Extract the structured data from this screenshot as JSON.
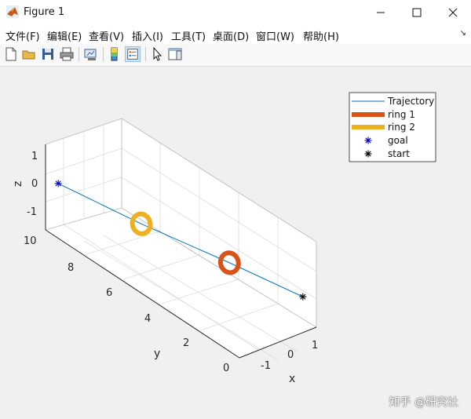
{
  "window": {
    "title": "Figure 1",
    "controls": {
      "minimize": "—",
      "maximize": "☐",
      "close": "✕"
    }
  },
  "menubar": {
    "items": [
      "文件(F)",
      "编辑(E)",
      "查看(V)",
      "插入(I)",
      "工具(T)",
      "桌面(D)",
      "窗口(W)",
      "帮助(H)"
    ]
  },
  "toolbar": {
    "buttons": [
      "new-figure-icon",
      "open-file-icon",
      "save-icon",
      "print-icon",
      "link-plot-icon",
      "colorbar-icon",
      "legend-icon",
      "pointer-icon",
      "property-editor-icon"
    ]
  },
  "chart_data": {
    "type": "line",
    "view": "3d",
    "xlabel": "x",
    "ylabel": "y",
    "zlabel": "z",
    "xticks": [
      "-1",
      "0",
      "1"
    ],
    "yticks": [
      "0",
      "2",
      "4",
      "6",
      "8",
      "10"
    ],
    "zticks": [
      "-1",
      "0",
      "1"
    ],
    "xlim": [
      -1.5,
      1.5
    ],
    "ylim": [
      0,
      10
    ],
    "zlim": [
      -1.5,
      1.5
    ],
    "grid": true,
    "legend_position": "top-right",
    "colors": {
      "trajectory": "#0072bd",
      "ring1": "#d95319",
      "ring2": "#edb120",
      "goal": "#0000b8",
      "start": "#000000"
    },
    "series": [
      {
        "name": "Trajectory",
        "x": [
          1.0,
          0.4,
          -0.4,
          -1.0
        ],
        "y": [
          0.0,
          3.0,
          6.5,
          10.0
        ],
        "z": [
          0.0,
          0.0,
          0.0,
          0.0
        ]
      },
      {
        "name": "ring 1",
        "center": [
          0.4,
          3.0,
          0.0
        ],
        "radius": 0.35
      },
      {
        "name": "ring 2",
        "center": [
          -0.4,
          6.5,
          0.0
        ],
        "radius": 0.35
      },
      {
        "name": "goal",
        "x": [
          -1.0
        ],
        "y": [
          10.0
        ],
        "z": [
          0.0
        ]
      },
      {
        "name": "start",
        "x": [
          1.0
        ],
        "y": [
          0.0
        ],
        "z": [
          0.0
        ]
      }
    ]
  },
  "legend": {
    "entries": [
      "Trajectory",
      "ring 1",
      "ring 2",
      "goal",
      "start"
    ]
  },
  "watermark": "知乎 @研究社"
}
